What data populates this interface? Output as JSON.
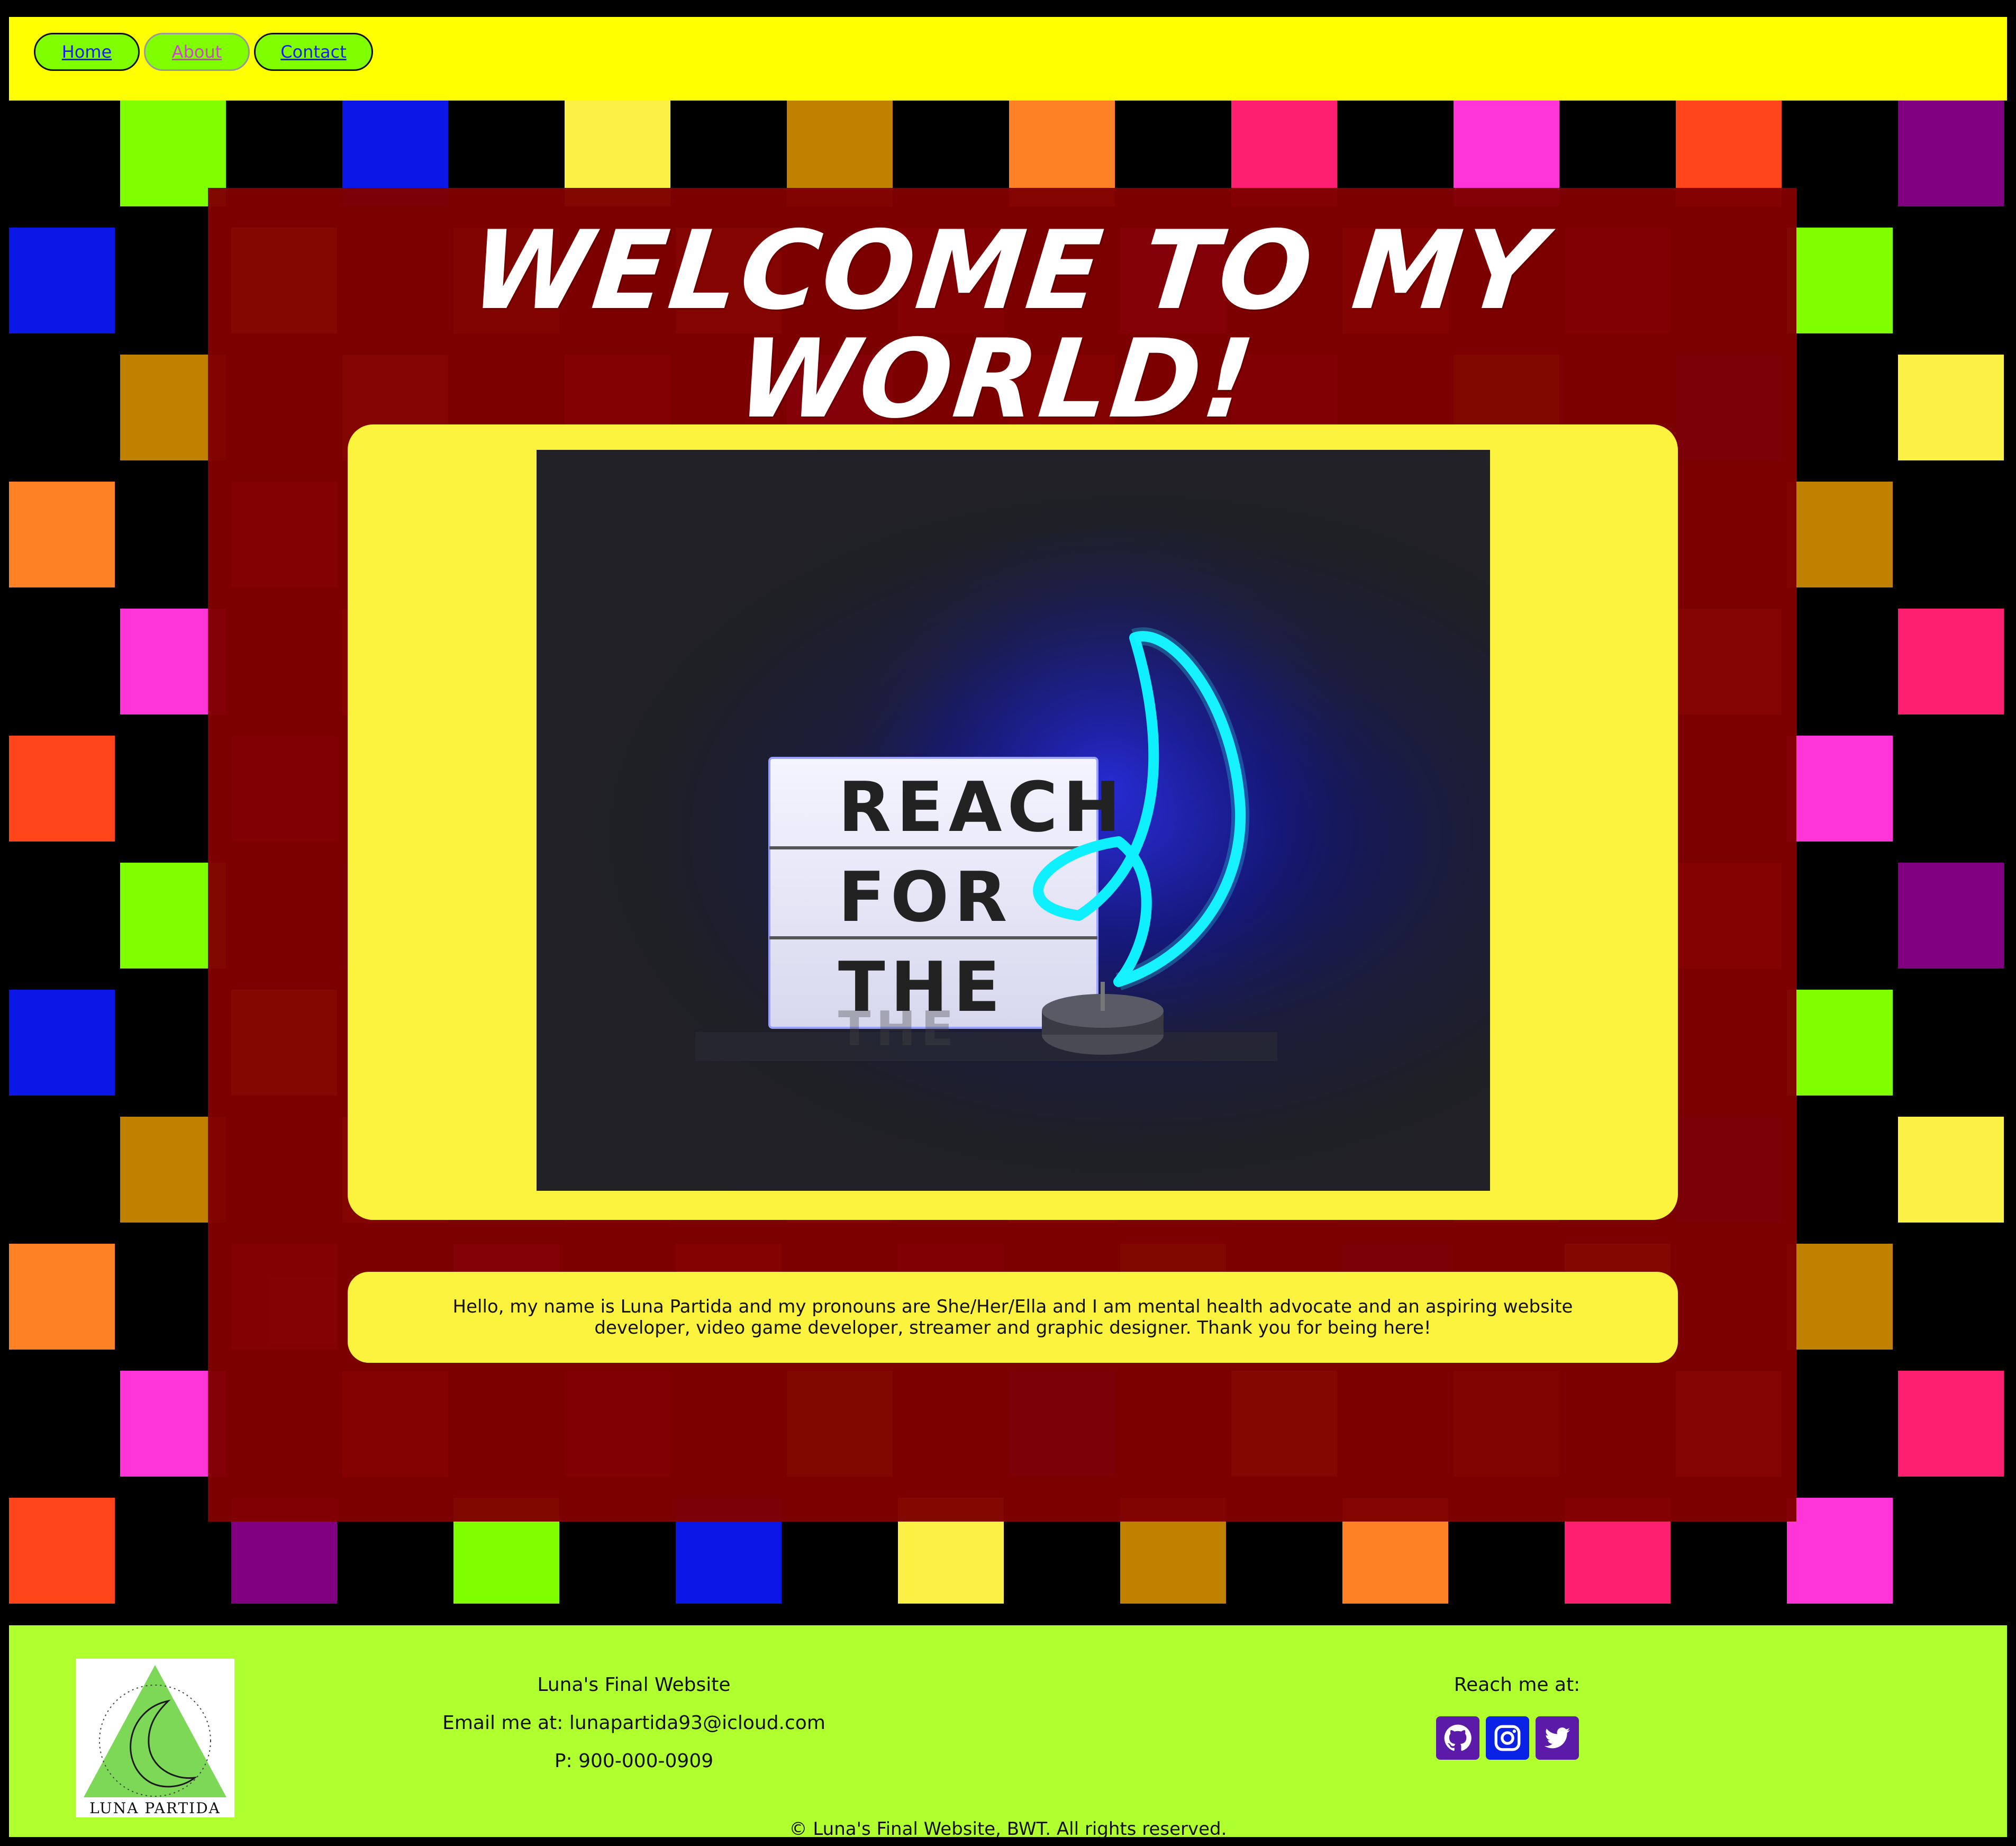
{
  "nav": {
    "items": [
      {
        "label": "Home"
      },
      {
        "label": "About"
      },
      {
        "label": "Contact"
      }
    ],
    "active": "About"
  },
  "header": {
    "title": "WELCOME TO MY WORLD!"
  },
  "hero": {
    "lightbox_lines": [
      "REACH",
      "FOR",
      "THE"
    ],
    "reflection": "THE"
  },
  "bio": {
    "text": "Hello, my name is Luna Partida and my pronouns are She/Her/Ella and I am mental health advocate and an aspiring website developer, video game developer, streamer and graphic designer. Thank you for being here!"
  },
  "footer": {
    "logo_text": "LUNA PARTIDA",
    "site_name": "Luna's Final Website",
    "email": "Email me at: lunapartida93@icloud.com",
    "phone": "P: 900-000-0909",
    "reach_label": "Reach me at:",
    "social": [
      {
        "icon": "github-icon",
        "color": "#5b1aa8"
      },
      {
        "icon": "instagram-icon",
        "color": "#0a22e6"
      },
      {
        "icon": "twitter-icon",
        "color": "#5b1aa8"
      }
    ],
    "copyright": "© Luna's Final Website, BWT. All rights reserved."
  },
  "colors": {
    "nav_bg": "#ffff00",
    "nav_button": "#7fff00",
    "panel": "#800000",
    "card": "#fcf33f",
    "footer_bg": "#b0ff2e",
    "checker": [
      "#ff8126",
      "#7fff00",
      "#ff1f70",
      "#0a17e6",
      "#ff35d8",
      "#fbf043",
      "#ff4519",
      "#c08000",
      "#800080"
    ]
  }
}
